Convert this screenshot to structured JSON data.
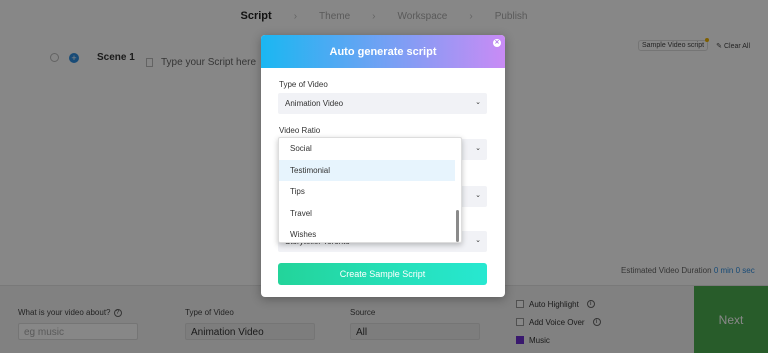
{
  "steps": [
    "Script",
    "Theme",
    "Workspace",
    "Publish"
  ],
  "scene": {
    "label": "Scene 1",
    "script_placeholder": "Type your Script here"
  },
  "top_right": {
    "sample_video": "Sample Video script",
    "clear_all": "Clear All"
  },
  "estimated": {
    "label": "Estimated Video Duration",
    "value": "0 min 0 sec"
  },
  "bottom": {
    "about_label": "What is your video about?",
    "about_placeholder": "eg music",
    "type_label": "Type of Video",
    "type_value": "Animation Video",
    "source_label": "Source",
    "source_value": "All",
    "checks": [
      {
        "label": "Auto Highlight",
        "checked": false
      },
      {
        "label": "Add Voice Over",
        "checked": false
      },
      {
        "label": "Music",
        "checked": true
      }
    ],
    "next": "Next"
  },
  "modal": {
    "title": "Auto generate script",
    "type_label": "Type of Video",
    "type_value": "Animation Video",
    "ratio_label": "Video Ratio",
    "fourth_value": "Storyteller Toronto",
    "generate": "Create Sample Script",
    "dropdown_options": [
      "Social",
      "Testimonial",
      "Tips",
      "Travel",
      "Wishes"
    ],
    "dropdown_selected": "Testimonial"
  },
  "colors": {
    "header_start": "#1ab7f2",
    "header_end": "#c98bf5",
    "button_start": "#23d49a",
    "button_end": "#27e8d1",
    "next": "#4caf50",
    "accent": "#2f8fe0"
  }
}
